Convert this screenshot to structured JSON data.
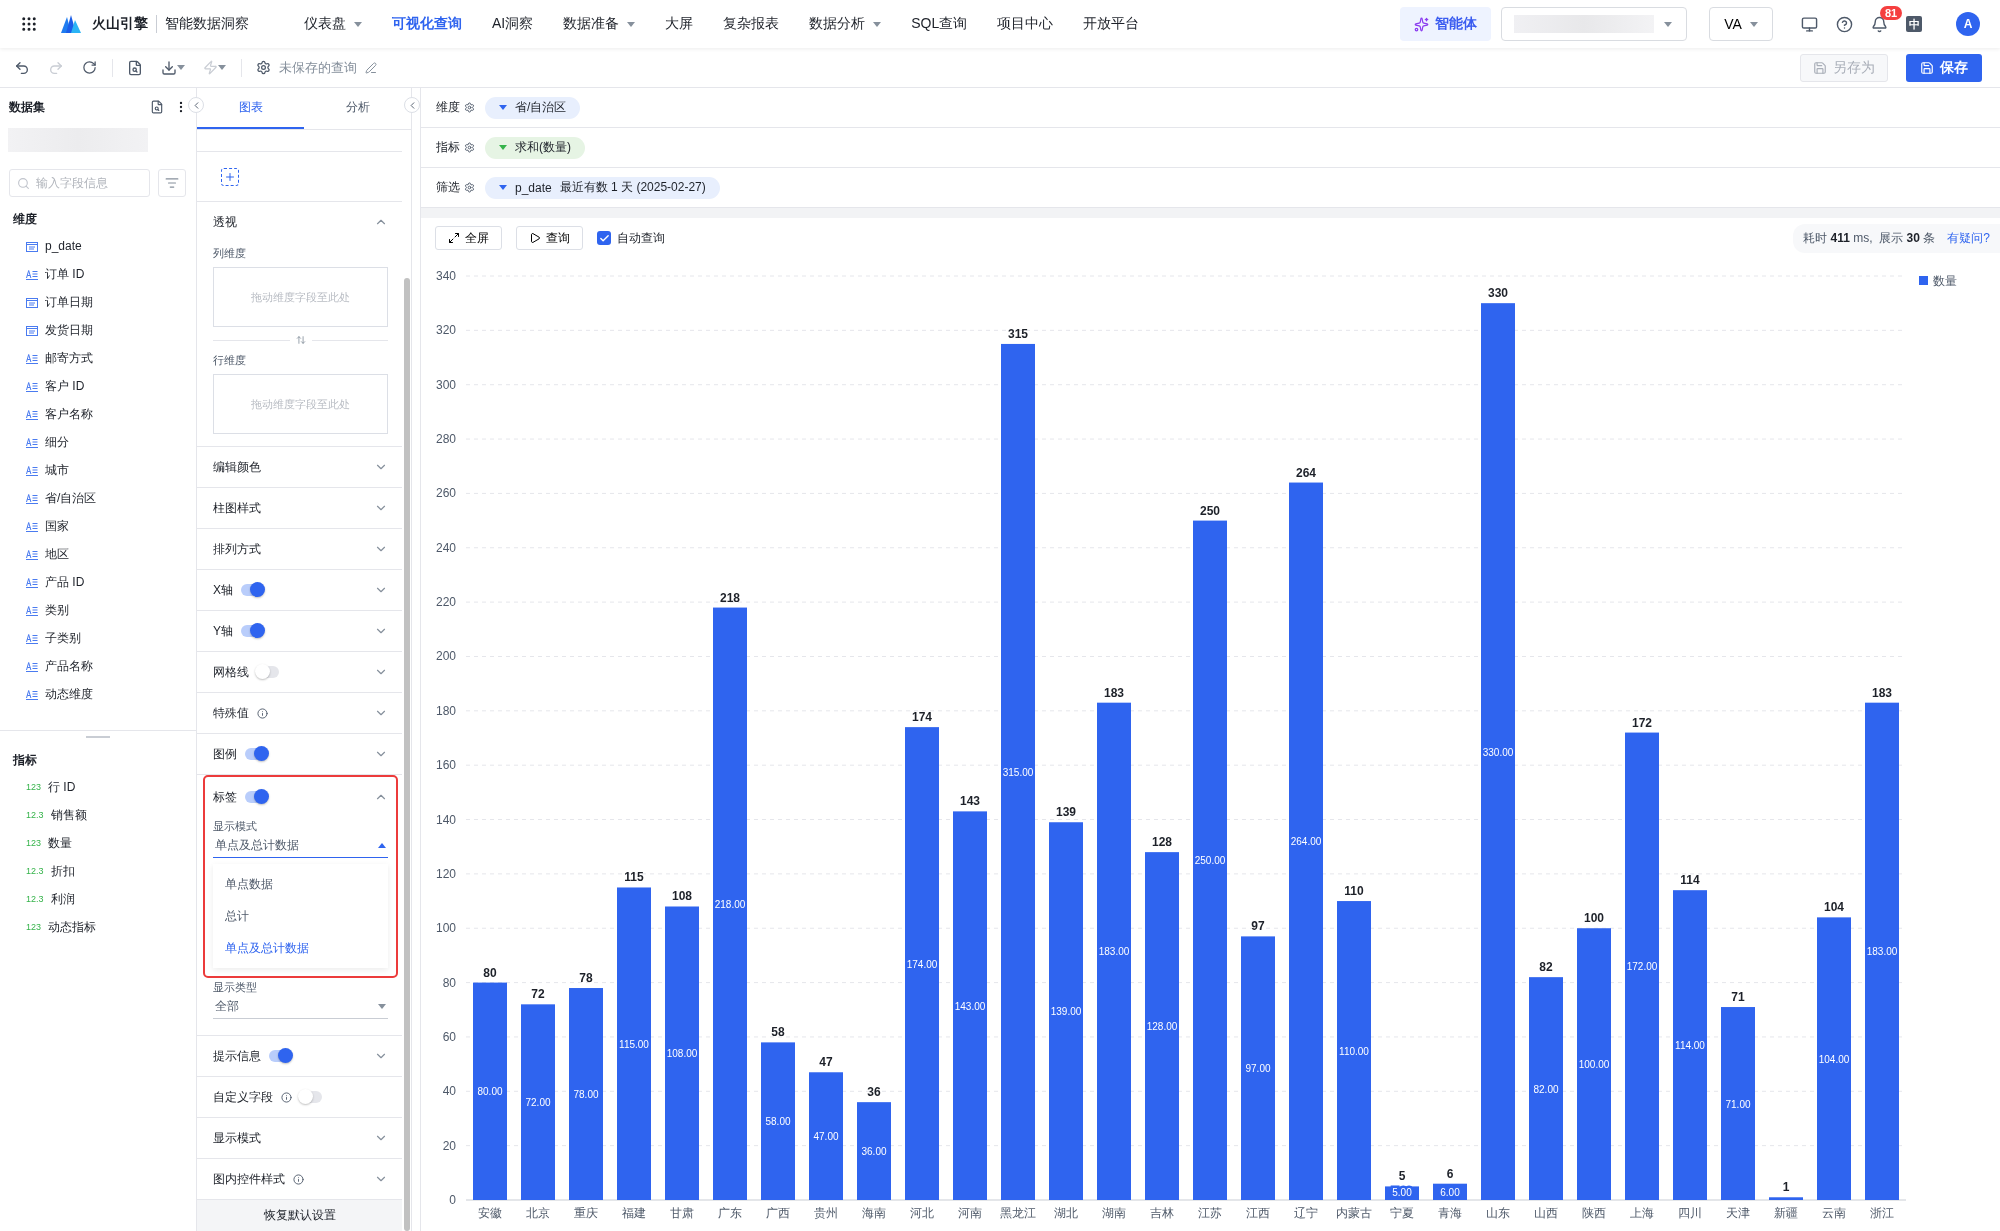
{
  "top_nav": {
    "brand": "火山引擎",
    "product": "智能数据洞察",
    "items": [
      {
        "label": "仪表盘",
        "dropdown": true,
        "selected": false
      },
      {
        "label": "可视化查询",
        "dropdown": false,
        "selected": true
      },
      {
        "label": "AI洞察",
        "dropdown": false,
        "selected": false
      },
      {
        "label": "数据准备",
        "dropdown": true,
        "selected": false
      },
      {
        "label": "大屏",
        "dropdown": false,
        "selected": false
      },
      {
        "label": "复杂报表",
        "dropdown": false,
        "selected": false
      },
      {
        "label": "数据分析",
        "dropdown": true,
        "selected": false
      },
      {
        "label": "SQL查询",
        "dropdown": false,
        "selected": false
      },
      {
        "label": "项目中心",
        "dropdown": false,
        "selected": false
      },
      {
        "label": "开放平台",
        "dropdown": false,
        "selected": false
      }
    ],
    "agent_button": "智能体",
    "space_select": "VA",
    "notification_count": "81",
    "language": "中",
    "avatar": "A"
  },
  "toolbar": {
    "query_title": "未保存的查询",
    "save_as": {
      "label": "另存为",
      "disabled": true
    },
    "save": {
      "label": "保存",
      "disabled": false
    }
  },
  "dataset_panel": {
    "title": "数据集",
    "search": {
      "placeholder": "输入字段信息"
    },
    "dimensions": {
      "title": "维度",
      "fields": [
        {
          "name": "p_date",
          "kind": "date"
        },
        {
          "name": "订单 ID",
          "kind": "text"
        },
        {
          "name": "订单日期",
          "kind": "date"
        },
        {
          "name": "发货日期",
          "kind": "date"
        },
        {
          "name": "邮寄方式",
          "kind": "text"
        },
        {
          "name": "客户 ID",
          "kind": "text"
        },
        {
          "name": "客户名称",
          "kind": "text"
        },
        {
          "name": "细分",
          "kind": "text"
        },
        {
          "name": "城市",
          "kind": "text"
        },
        {
          "name": "省/自治区",
          "kind": "text"
        },
        {
          "name": "国家",
          "kind": "text"
        },
        {
          "name": "地区",
          "kind": "text"
        },
        {
          "name": "产品 ID",
          "kind": "text"
        },
        {
          "name": "类别",
          "kind": "text"
        },
        {
          "name": "子类别",
          "kind": "text"
        },
        {
          "name": "产品名称",
          "kind": "text"
        },
        {
          "name": "动态维度",
          "kind": "text"
        }
      ]
    },
    "measures": {
      "title": "指标",
      "fields": [
        {
          "name": "行 ID",
          "type_label": "123"
        },
        {
          "name": "销售额",
          "type_label": "12.3"
        },
        {
          "name": "数量",
          "type_label": "123"
        },
        {
          "name": "折扣",
          "type_label": "12.3"
        },
        {
          "name": "利润",
          "type_label": "12.3"
        },
        {
          "name": "动态指标",
          "type_label": "123"
        }
      ]
    }
  },
  "config_panel": {
    "tabs": [
      {
        "label": "图表",
        "selected": true
      },
      {
        "label": "分析",
        "selected": false
      }
    ],
    "pivot": {
      "title": "透视",
      "expanded": true,
      "zones": [
        {
          "label": "列维度",
          "placeholder": "拖动维度字段至此处"
        },
        {
          "label": "行维度",
          "placeholder": "拖动维度字段至此处"
        }
      ]
    },
    "sections": [
      {
        "title": "编辑颜色",
        "kind": "plain",
        "expanded": false
      },
      {
        "title": "柱图样式",
        "kind": "plain",
        "expanded": false
      },
      {
        "title": "排列方式",
        "kind": "plain",
        "expanded": false
      },
      {
        "title": "X轴",
        "kind": "toggle",
        "on": true,
        "expanded": false
      },
      {
        "title": "Y轴",
        "kind": "toggle",
        "on": true,
        "expanded": false
      },
      {
        "title": "网格线",
        "kind": "toggle",
        "on": false,
        "expanded": false
      },
      {
        "title": "特殊值",
        "kind": "info",
        "expanded": false
      },
      {
        "title": "图例",
        "kind": "toggle",
        "on": true,
        "expanded": false
      },
      {
        "title": "标签",
        "kind": "toggle",
        "on": true,
        "expanded": true,
        "highlighted": true,
        "fields": [
          {
            "label": "显示模式",
            "value": "单点及总计数据",
            "open": true,
            "options": [
              {
                "label": "单点数据",
                "selected": false
              },
              {
                "label": "总计",
                "selected": false
              },
              {
                "label": "单点及总计数据",
                "selected": true
              }
            ]
          },
          {
            "label": "显示类型",
            "value": "全部",
            "open": false
          }
        ]
      },
      {
        "title": "提示信息",
        "kind": "toggle",
        "on": true,
        "expanded": false
      },
      {
        "title": "自定义字段",
        "kind": "info-toggle",
        "on": false
      },
      {
        "title": "显示模式",
        "kind": "plain",
        "expanded": false
      },
      {
        "title": "图内控件样式",
        "kind": "info",
        "expanded": false
      }
    ],
    "reset_button": "恢复默认设置"
  },
  "shelves": [
    {
      "label": "维度",
      "kind": "dimension",
      "pill": "省/自治区"
    },
    {
      "label": "指标",
      "kind": "measure",
      "pill": "求和(数量)"
    },
    {
      "label": "筛选",
      "kind": "filter",
      "pill": "p_date",
      "detail": "最近有数 1 天 (2025-02-27)"
    }
  ],
  "chart_toolbar": {
    "fullscreen": "全屏",
    "query": "查询",
    "auto_query": {
      "label": "自动查询",
      "checked": true
    },
    "stats": "耗时 **411** ms,  展示 **30** 条",
    "help_link": "有疑问?"
  },
  "chart": {
    "chart_data": {
      "type": "bar",
      "categories": [
        "安徽",
        "北京",
        "重庆",
        "福建",
        "甘肃",
        "广东",
        "广西",
        "贵州",
        "海南",
        "河北",
        "河南",
        "黑龙江",
        "湖北",
        "湖南",
        "吉林",
        "江苏",
        "江西",
        "辽宁",
        "内蒙古",
        "宁夏",
        "青海",
        "山东",
        "山西",
        "陕西",
        "上海",
        "四川",
        "天津",
        "新疆",
        "云南",
        "浙江"
      ],
      "series": [
        {
          "name": "数量",
          "color": "#2f64ef",
          "values": [
            80,
            72,
            78,
            115,
            108,
            218,
            58,
            47,
            36,
            174,
            143,
            315,
            139,
            183,
            128,
            250,
            97,
            264,
            110,
            5,
            6,
            330,
            82,
            100,
            172,
            114,
            71,
            1,
            104,
            183
          ]
        }
      ],
      "value_labels": [
        "80.00",
        "72.00",
        "78.00",
        "115.00",
        "108.00",
        "218.00",
        "58.00",
        "47.00",
        "36.00",
        "174.00",
        "143.00",
        "315.00",
        "139.00",
        "183.00",
        "128.00",
        "250.00",
        "97.00",
        "264.00",
        "110.00",
        "5.00",
        "6.00",
        "330.00",
        "82.00",
        "100.00",
        "172.00",
        "114.00",
        "71.00",
        null,
        "104.00",
        "183.00"
      ],
      "grid": true,
      "ylim": [
        0,
        340
      ],
      "yticks": [
        0,
        20,
        40,
        60,
        80,
        100,
        120,
        140,
        160,
        180,
        200,
        220,
        240,
        260,
        280,
        300,
        320,
        340
      ],
      "data_labels": true
    }
  }
}
